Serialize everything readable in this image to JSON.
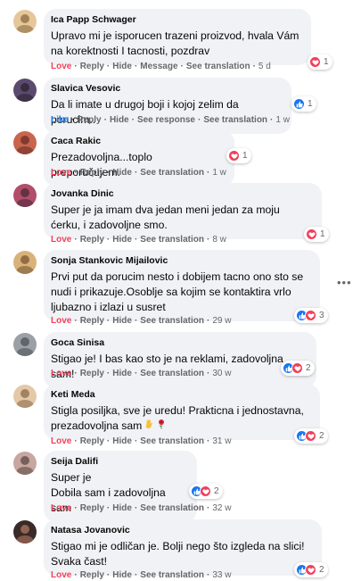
{
  "comments": [
    {
      "author": "Ica Papp Schwager",
      "text": "Upravo mi je isporucen trazeni proizvod, hvala Vám na korektnosti I tacnosti, pozdrav",
      "actions": [
        "Love",
        "Reply",
        "Hide",
        "Message",
        "See translation"
      ],
      "time": "5 d",
      "reaction_count": "1",
      "reaction_icons": [
        "love"
      ],
      "avatar_colors": [
        "#e6c79a",
        "#8a6a3f"
      ]
    },
    {
      "author": "Slavica Vesovic",
      "text": "Da li imate u drugoj boji i kojoj zelim da porucim..",
      "actions": [
        "Like",
        "Reply",
        "Hide",
        "See response",
        "See translation"
      ],
      "time": "1 w",
      "reaction_count": "1",
      "reaction_icons": [
        "like"
      ],
      "avatar_colors": [
        "#5c4a6e",
        "#2b2230"
      ]
    },
    {
      "author": "Caca Rakic",
      "text": "Prezadovoljna...toplo preporučujem.",
      "actions": [
        "Love",
        "Reply",
        "Hide",
        "See translation"
      ],
      "time": "1 w",
      "reaction_count": "1",
      "reaction_icons": [
        "love"
      ],
      "avatar_colors": [
        "#c9654f",
        "#6b2e24"
      ]
    },
    {
      "author": "Jovanka Dinic",
      "text": "Super je ja imam dva jedan meni jedan za moju ćerku, i zadovoljne smo.",
      "actions": [
        "Love",
        "Reply",
        "Hide",
        "See translation"
      ],
      "time": "8 w",
      "reaction_count": "1",
      "reaction_icons": [
        "love"
      ],
      "avatar_colors": [
        "#b24e6a",
        "#4a2a3a"
      ]
    },
    {
      "author": "Sonja Stankovic Mijailovic",
      "text": "Prvi put da porucim nesto i dobijem tacno ono sto se nudi i prikazuje.Osoblje sa kojim se kontaktira vrlo ljubazno i izlazi u susret",
      "actions": [
        "Love",
        "Reply",
        "Hide",
        "See translation"
      ],
      "time": "29 w",
      "reaction_count": "3",
      "reaction_icons": [
        "like",
        "love"
      ],
      "avatar_colors": [
        "#d9b27a",
        "#7a5533"
      ]
    },
    {
      "author": "Goca Sinisa",
      "text": "Stigao je! I bas kao sto je na reklami, zadovoljna sam!",
      "actions": [
        "Love",
        "Reply",
        "Hide",
        "See translation"
      ],
      "time": "30 w",
      "reaction_count": "2",
      "reaction_icons": [
        "like",
        "love"
      ],
      "avatar_colors": [
        "#9aa0a6",
        "#4d5257"
      ]
    },
    {
      "author": "Keti Meda",
      "text": "Stigla posiljka, sve je uredu! Prakticna i jednostavna, prezadovoljna sam",
      "actions": [
        "Love",
        "Reply",
        "Hide",
        "See translation"
      ],
      "time": "31 w",
      "reaction_count": "2",
      "reaction_icons": [
        "like",
        "love"
      ],
      "avatar_colors": [
        "#e3c9a8",
        "#8c6b4a"
      ],
      "emoji": [
        "hand-emoji",
        "rose-emoji"
      ]
    },
    {
      "author": "Seija Dalifi",
      "text": "Super je\nDobila sam i zadovoljna sam",
      "actions": [
        "Love",
        "Reply",
        "Hide",
        "See translation"
      ],
      "time": "32 w",
      "reaction_count": "2",
      "reaction_icons": [
        "like",
        "love"
      ],
      "avatar_colors": [
        "#c7a7a0",
        "#5e4743"
      ]
    },
    {
      "author": "Natasa Jovanovic",
      "text": "Stigao mi je odličan je. Bolji nego što izgleda na slici! Svaka čast!",
      "actions": [
        "Love",
        "Reply",
        "Hide",
        "See translation"
      ],
      "time": "33 w",
      "reaction_count": "2",
      "reaction_icons": [
        "like",
        "love"
      ],
      "avatar_colors": [
        "#3a2a28",
        "#b07860"
      ]
    }
  ],
  "colors": {
    "bubble": "#f0f2f5",
    "meta": "#65676b",
    "love": "#f33e58",
    "like": "#1877f2"
  },
  "more_icon": "more-options-icon"
}
